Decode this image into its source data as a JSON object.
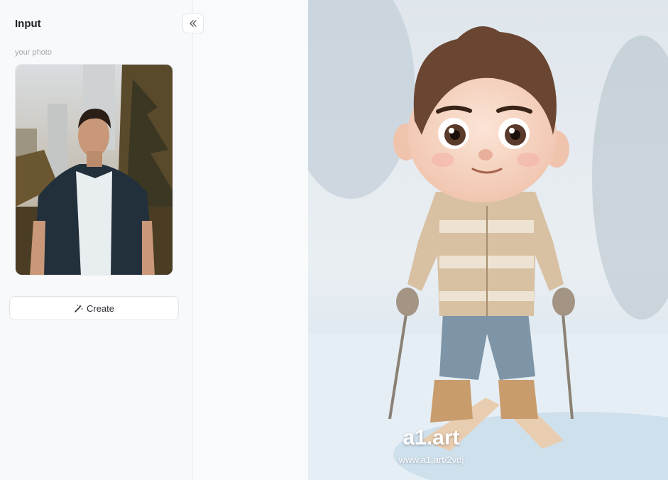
{
  "sidebar": {
    "title": "Input",
    "photo_label": "your photo",
    "create_label": "Create",
    "collapse_icon": "double-chevron-left-icon"
  },
  "result": {
    "watermark_logo": "a1.art",
    "watermark_url": "www.a1.art/2vdj"
  },
  "colors": {
    "panel_bg": "#f8f9fb",
    "border": "#e1e4e8",
    "text_primary": "#1c1f24",
    "text_muted": "#a3a8b0"
  }
}
